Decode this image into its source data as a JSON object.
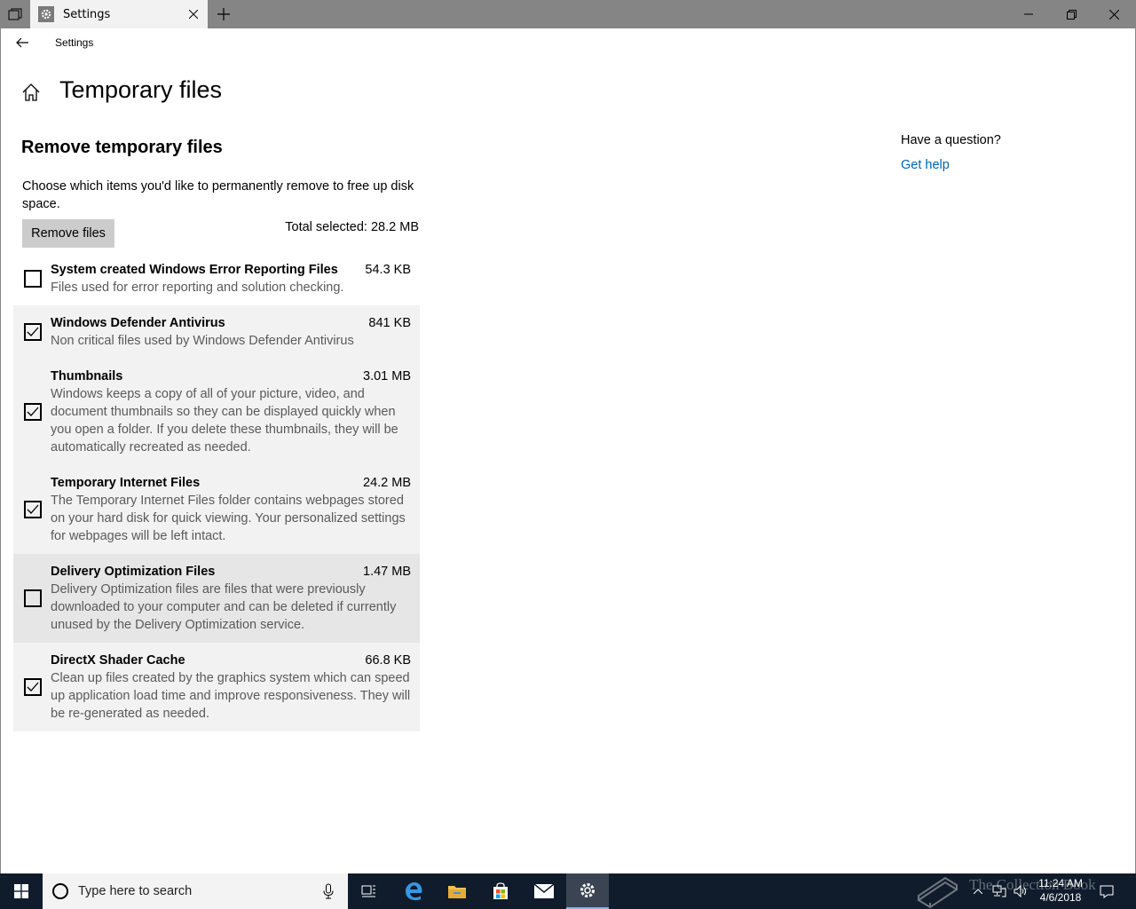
{
  "window": {
    "tab_title": "Settings",
    "app_name": "Settings"
  },
  "page": {
    "title": "Temporary files",
    "section_title": "Remove temporary files",
    "description": "Choose which items you'd like to permanently remove to free up disk space.",
    "remove_button": "Remove files",
    "total_selected": "Total selected: 28.2 MB"
  },
  "items": [
    {
      "name": "System created Windows Error Reporting Files",
      "size": "54.3 KB",
      "detail": "Files used for error reporting and solution checking.",
      "checked": false
    },
    {
      "name": "Windows Defender Antivirus",
      "size": "841 KB",
      "detail": "Non critical files used by Windows Defender Antivirus",
      "checked": true
    },
    {
      "name": "Thumbnails",
      "size": "3.01 MB",
      "detail": "Windows keeps a copy of all of your picture, video, and document thumbnails so they can be displayed quickly when you open a folder. If you delete these thumbnails, they will be automatically recreated as needed.",
      "checked": true
    },
    {
      "name": "Temporary Internet Files",
      "size": "24.2 MB",
      "detail": "The Temporary Internet Files folder contains webpages stored on your hard disk for quick viewing. Your personalized settings for webpages will be left intact.",
      "checked": true
    },
    {
      "name": "Delivery Optimization Files",
      "size": "1.47 MB",
      "detail": "Delivery Optimization files are files that were previously downloaded to your computer and can be deleted if currently unused by the Delivery Optimization service.",
      "checked": false
    },
    {
      "name": "DirectX Shader Cache",
      "size": "66.8 KB",
      "detail": "Clean up files created by the graphics system which can speed up application load time and improve responsiveness. They will be re-generated as needed.",
      "checked": true
    }
  ],
  "help": {
    "question": "Have a question?",
    "link": "Get help"
  },
  "taskbar": {
    "search_placeholder": "Type here to search",
    "time": "11:24 AM",
    "date": "4/6/2018",
    "watermark": "The Collection Book"
  },
  "colors": {
    "accent": "#0063b1",
    "titlebar": "#858585",
    "taskbar": "#101c2c"
  }
}
